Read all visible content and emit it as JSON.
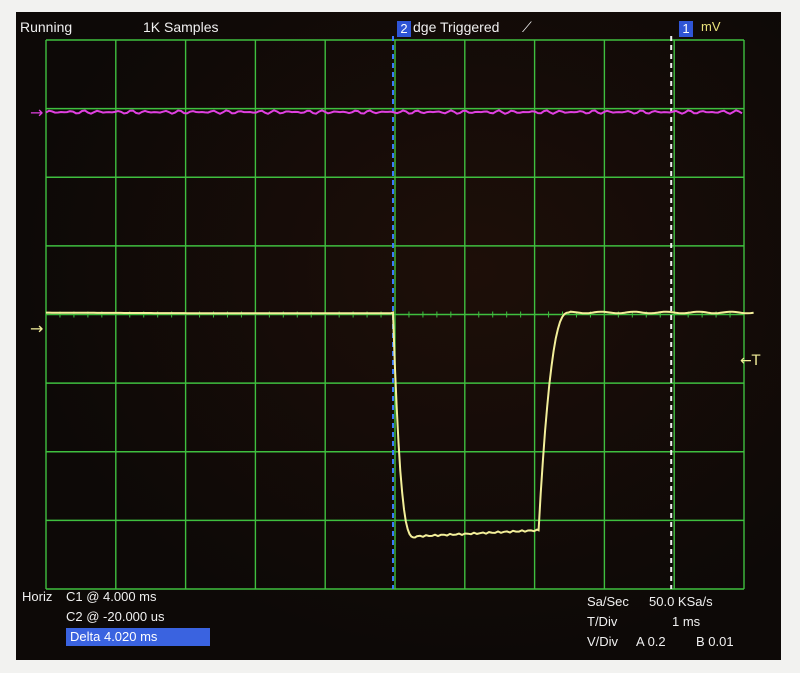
{
  "header": {
    "run_state": "Running",
    "samples": "1K Samples",
    "cursor2_label": "2",
    "trigger_mode": "dge Triggered",
    "trigger_slope": "⟋",
    "cursor1_label": "1",
    "units": "mV"
  },
  "markers": {
    "ch_a_arrow": "→",
    "ch_b_arrow": "→",
    "trigger_level": "←T"
  },
  "footer": {
    "horiz_label": "Horiz",
    "c1": "C1 @ 4.000 ms",
    "c2": "C2 @ -20.000 us",
    "delta": "Delta 4.020 ms",
    "sa_label": "Sa/Sec",
    "sa_value": "50.0 KSa/s",
    "tdiv_label": "T/Div",
    "tdiv_value": "1 ms",
    "vdiv_label": "V/Div",
    "vdiv_a": "A 0.2",
    "vdiv_b": "B 0.01"
  },
  "colors": {
    "grid": "#3fbf3f",
    "trace_a": "#f3ef9a",
    "trace_b": "#e040e0",
    "cursor_c2": "#3a78ff",
    "cursor_c1": "#f0f0f0",
    "marker_bg": "#2f55d6"
  },
  "traces": {
    "time_per_div_ms": 1,
    "divisions": 10,
    "channel_a_step": {
      "pulse_start_ms": 0.0,
      "pulse_end_ms": 2.0,
      "level_high_div": 0,
      "level_low_div": 3.0
    },
    "channel_b_level": "flat"
  }
}
